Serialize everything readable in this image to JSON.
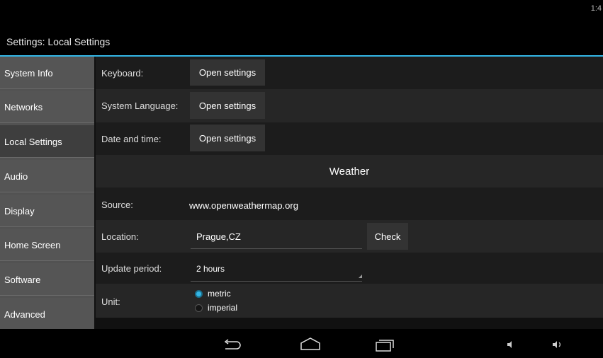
{
  "status_bar": {
    "time": "1:4"
  },
  "title_bar": {
    "title": "Settings: Local Settings"
  },
  "sidebar": {
    "items": [
      {
        "label": "System Info"
      },
      {
        "label": "Networks"
      },
      {
        "label": "Local Settings"
      },
      {
        "label": "Audio"
      },
      {
        "label": "Display"
      },
      {
        "label": "Home Screen"
      },
      {
        "label": "Software"
      },
      {
        "label": "Advanced"
      }
    ],
    "active_index": 2
  },
  "settings": {
    "keyboard": {
      "label": "Keyboard:",
      "button": "Open settings"
    },
    "language": {
      "label": "System Language:",
      "button": "Open settings"
    },
    "datetime": {
      "label": "Date and time:",
      "button": "Open settings"
    }
  },
  "weather": {
    "header": "Weather",
    "source": {
      "label": "Source:",
      "value": "www.openweathermap.org"
    },
    "location": {
      "label": "Location:",
      "value": "Prague,CZ",
      "button": "Check"
    },
    "update_period": {
      "label": "Update period:",
      "value": "2 hours"
    },
    "unit": {
      "label": "Unit:",
      "options": [
        {
          "label": "metric",
          "selected": true
        },
        {
          "label": "imperial",
          "selected": false
        }
      ]
    }
  },
  "nav_bar": {
    "icons": [
      "back-icon",
      "home-icon",
      "recent-apps-icon",
      "volume-down-icon",
      "volume-up-icon"
    ]
  },
  "colors": {
    "accent": "#33b5e5",
    "sidebar_bg": "#555555",
    "sidebar_active": "#3e3e3e"
  }
}
